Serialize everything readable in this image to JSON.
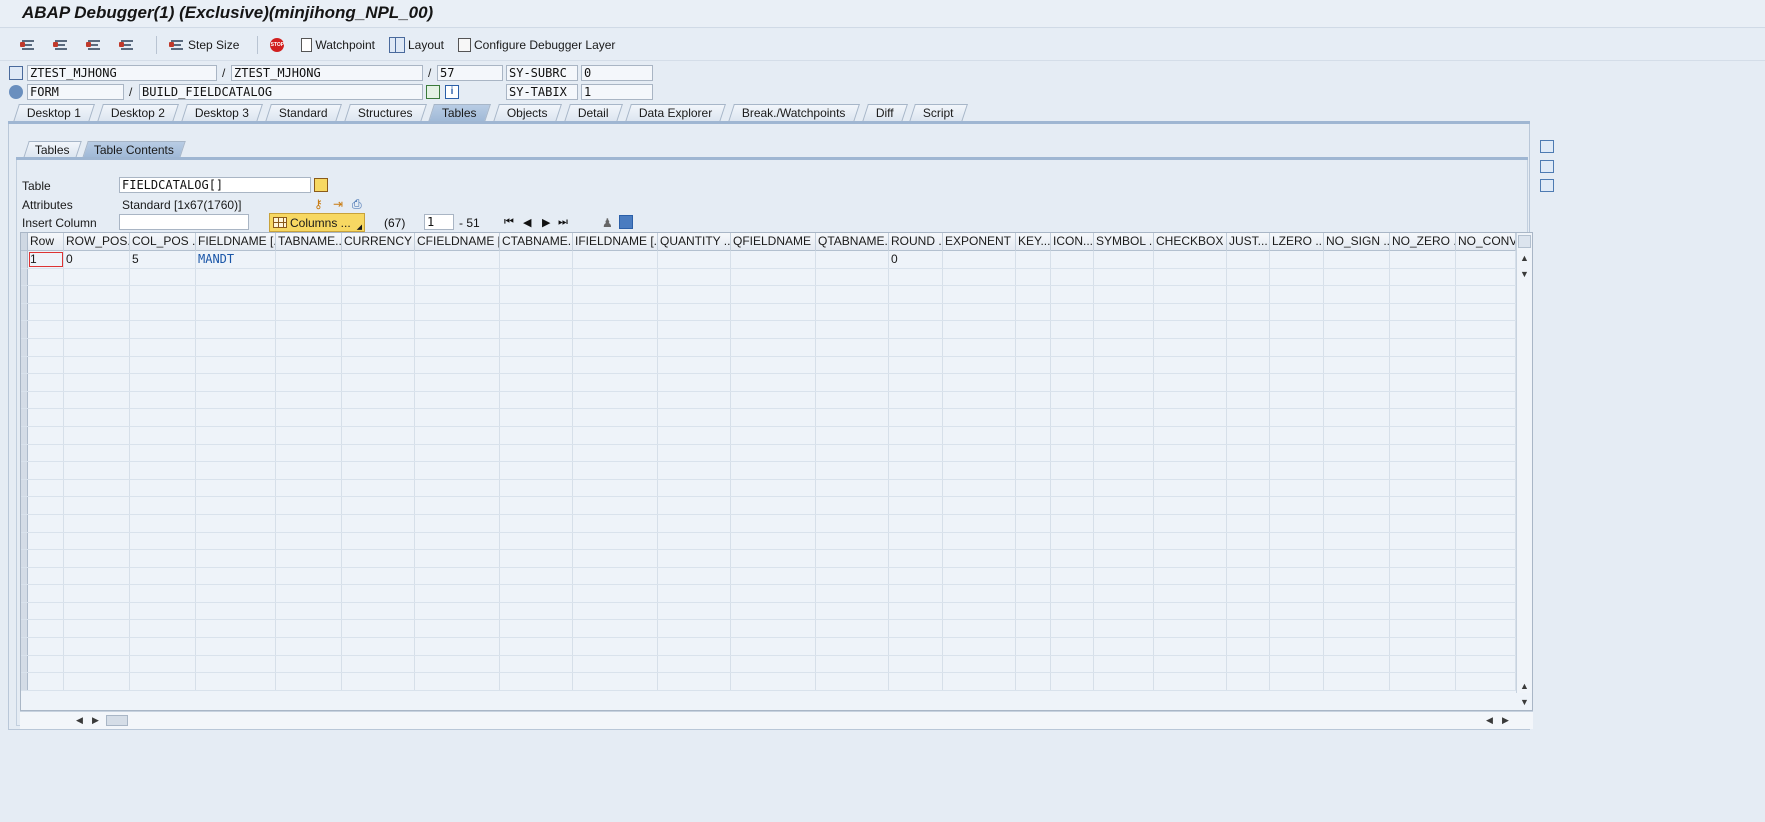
{
  "window": {
    "title": "ABAP Debugger(1)  (Exclusive)(minjihong_NPL_00)"
  },
  "toolbar": {
    "step_size": "Step Size",
    "watchpoint": "Watchpoint",
    "layout": "Layout",
    "configure_layer": "Configure Debugger Layer",
    "stop_icon_text": "STOP"
  },
  "context": {
    "program": "ZTEST_MJHONG",
    "include": "ZTEST_MJHONG",
    "line": "57",
    "event_type": "FORM",
    "event_name": "BUILD_FIELDCATALOG",
    "sy_subrc_label": "SY-SUBRC",
    "sy_subrc_value": "0",
    "sy_tabix_label": "SY-TABIX",
    "sy_tabix_value": "1",
    "slash": "/"
  },
  "tabs": [
    {
      "label": "Desktop 1"
    },
    {
      "label": "Desktop 2"
    },
    {
      "label": "Desktop 3"
    },
    {
      "label": "Standard"
    },
    {
      "label": "Structures"
    },
    {
      "label": "Tables",
      "active": true
    },
    {
      "label": "Objects"
    },
    {
      "label": "Detail"
    },
    {
      "label": "Data Explorer"
    },
    {
      "label": "Break./Watchpoints"
    },
    {
      "label": "Diff"
    },
    {
      "label": "Script"
    }
  ],
  "subtabs": [
    {
      "label": "Tables"
    },
    {
      "label": "Table Contents",
      "active": true
    }
  ],
  "table_info": {
    "table_label": "Table",
    "table_value": "FIELDCATALOG[]",
    "attributes_label": "Attributes",
    "attributes_value": "Standard [1x67(1760)]",
    "insert_column_label": "Insert Column",
    "insert_column_value": "",
    "columns_button": "Columns ...",
    "total_columns": "(67)",
    "from_col": "1",
    "to_col": "- 51"
  },
  "grid": {
    "columns": [
      "Row",
      "ROW_POS...",
      "COL_POS ...",
      "FIELDNAME [...",
      "TABNAME...",
      "CURRENCY ...",
      "CFIELDNAME [...",
      "CTABNAME...",
      "IFIELDNAME [...",
      "QUANTITY ...",
      "QFIELDNAME ...",
      "QTABNAME...",
      "ROUND ...",
      "EXPONENT ...",
      "KEY...",
      "ICON...",
      "SYMBOL ...",
      "CHECKBOX ...",
      "JUST...",
      "LZERO ...",
      "NO_SIGN ...",
      "NO_ZERO ...",
      "NO_CONV"
    ],
    "rows": [
      [
        "1",
        "0",
        "5",
        "MANDT",
        "",
        "",
        "",
        "",
        "",
        "",
        "",
        "",
        "0",
        "",
        "",
        "",
        "",
        "",
        "",
        "",
        "",
        "",
        ""
      ]
    ]
  }
}
